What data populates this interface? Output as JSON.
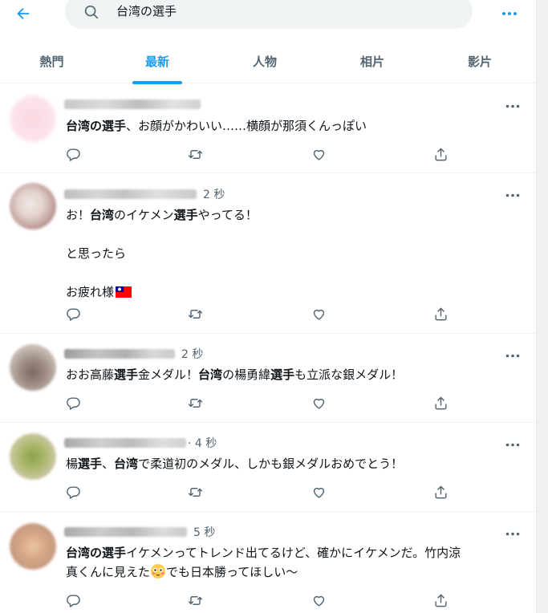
{
  "search": {
    "query": "台湾の選手"
  },
  "tabs": [
    {
      "label": "熱門",
      "active": false
    },
    {
      "label": "最新",
      "active": true
    },
    {
      "label": "人物",
      "active": false
    },
    {
      "label": "相片",
      "active": false
    },
    {
      "label": "影片",
      "active": false
    }
  ],
  "colors": {
    "accent": "#1d9bf0",
    "text": "#0f1419",
    "muted": "#536471",
    "search_bg": "#eff3f4"
  },
  "tweets": [
    {
      "time": "",
      "lines": [
        "台湾の選手、お顔がかわいい……横顔が那須くんっぽい"
      ],
      "bold": [
        "台湾の選手"
      ]
    },
    {
      "time": "2 秒",
      "lines": [
        "お！台湾のイケメン選手やってる！",
        "",
        "と思ったら",
        "",
        "お疲れ様"
      ],
      "bold": [
        "台湾",
        "選手"
      ],
      "flag": "taiwan-flag-emoji"
    },
    {
      "time": "2 秒",
      "lines": [
        "おお高藤選手金メダル！台湾の楊勇緯選手も立派な銀メダル！"
      ],
      "bold": [
        "選手",
        "台湾",
        "選手"
      ]
    },
    {
      "time": "· 4 秒",
      "lines": [
        "楊選手、台湾で柔道初のメダル、しかも銀メダルおめでとう！"
      ],
      "bold": [
        "選手",
        "台湾"
      ]
    },
    {
      "time": "5 秒",
      "lines": [
        "台湾の選手イケメンってトレンド出てるけど、確かにイケメンだ。竹内涼",
        "真くんに見えた",
        "でも日本勝ってほしい～"
      ],
      "bold": [
        "台湾の選手"
      ],
      "emoji": "flushed-face-emoji"
    }
  ]
}
